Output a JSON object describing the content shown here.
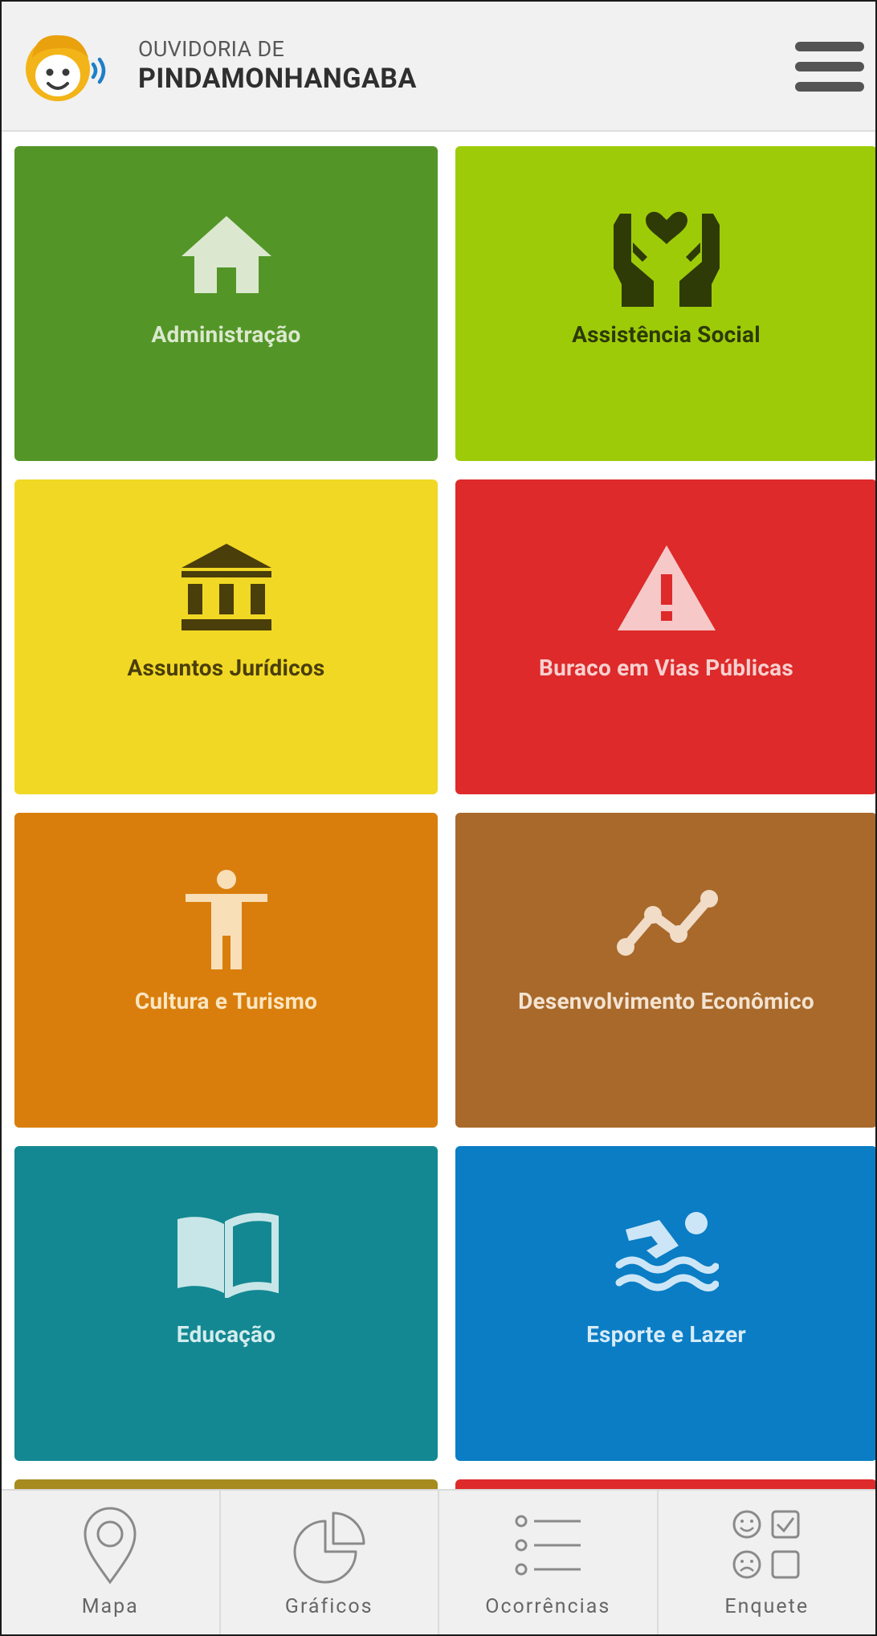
{
  "header": {
    "subtitle": "OUVIDORIA DE",
    "title": "PINDAMONHANGABA",
    "logo_icon": "child-face-broadcast-icon",
    "menu_icon": "hamburger-menu-icon"
  },
  "tiles": [
    {
      "label": "Administração",
      "icon": "house-icon",
      "bg": "#539627",
      "fg": "#dbe8cf",
      "icon_color": "#dbe8cf"
    },
    {
      "label": "Assistência Social",
      "icon": "hands-heart-icon",
      "bg": "#9ecb08",
      "fg": "#2c3a06",
      "icon_color": "#2e3b06"
    },
    {
      "label": "Assuntos Jurídicos",
      "icon": "courthouse-icon",
      "bg": "#f1d824",
      "fg": "#4a3e0a",
      "icon_color": "#4a3e0a"
    },
    {
      "label": "Buraco em Vias Públicas",
      "icon": "warning-triangle-icon",
      "bg": "#de2a2a",
      "fg": "#f8d0d0",
      "icon_color": "#f6c8c8"
    },
    {
      "label": "Cultura e Turismo",
      "icon": "person-arms-out-icon",
      "bg": "#d97e0c",
      "fg": "#fbe6c2",
      "icon_color": "#f9dfb8"
    },
    {
      "label": "Desenvolvimento Econômico",
      "icon": "trend-line-icon",
      "bg": "#a8692b",
      "fg": "#f3e3d2",
      "icon_color": "#f0dcc7"
    },
    {
      "label": "Educação",
      "icon": "open-book-icon",
      "bg": "#138892",
      "fg": "#d4ecee",
      "icon_color": "#c8e6e8"
    },
    {
      "label": "Esporte e Lazer",
      "icon": "swimmer-icon",
      "bg": "#0a7dc4",
      "fg": "#d6ebf8",
      "icon_color": "#cde6f7"
    }
  ],
  "partial_tiles": [
    {
      "bg": "#a88b1e"
    },
    {
      "bg": "#de2a2a"
    }
  ],
  "bottom_nav": [
    {
      "label": "Mapa",
      "icon": "map-pin-icon"
    },
    {
      "label": "Gráficos",
      "icon": "pie-chart-icon"
    },
    {
      "label": "Ocorrências",
      "icon": "list-icon"
    },
    {
      "label": "Enquete",
      "icon": "survey-faces-icon"
    }
  ]
}
